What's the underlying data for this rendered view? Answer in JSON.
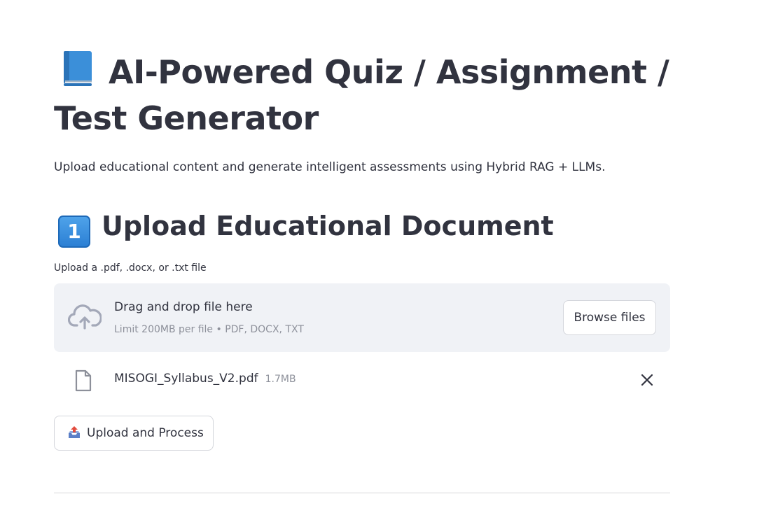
{
  "header": {
    "title": "AI-Powered Quiz / Assignment / Test Generator",
    "subtitle": "Upload educational content and generate intelligent assessments using Hybrid RAG + LLMs."
  },
  "section": {
    "number": "1",
    "title": "Upload Educational Document"
  },
  "uploader": {
    "label": "Upload a .pdf, .docx, or .txt file",
    "drop_title": "Drag and drop file here",
    "limit_text": "Limit 200MB per file • PDF, DOCX, TXT",
    "browse_label": "Browse files"
  },
  "uploaded_file": {
    "name": "MISOGI_Syllabus_V2.pdf",
    "size": "1.7MB"
  },
  "actions": {
    "process_label": "Upload and Process"
  },
  "icons": {
    "title_icon": "blue-book-icon",
    "section_icon": "keycap-one-icon",
    "upload_icon": "cloud-upload-icon",
    "file_icon": "document-icon",
    "remove_icon": "close-icon",
    "process_icon": "outbox-tray-icon"
  },
  "colors": {
    "text": "#31333f",
    "muted": "#8d909a",
    "dropzone_bg": "#f0f2f6",
    "border": "#d4d6dc"
  }
}
